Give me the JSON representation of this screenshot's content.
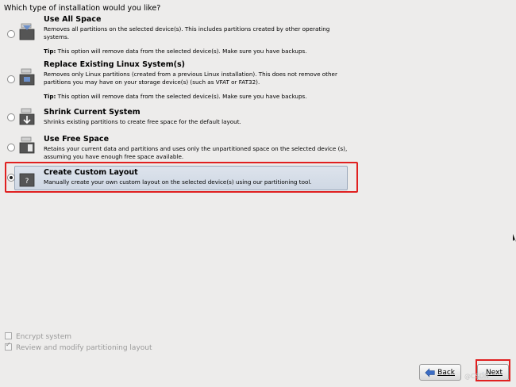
{
  "page": {
    "title": "Which type of installation would you like?"
  },
  "options": [
    {
      "title": "Use All Space",
      "description": "Removes all partitions on the selected device(s).  This includes partitions created by other operating systems.",
      "tip_label": "Tip:",
      "tip_text": " This option will remove data from the selected device(s).  Make sure you have backups.",
      "selected": false
    },
    {
      "title": "Replace Existing Linux System(s)",
      "description": "Removes only Linux partitions (created from a previous Linux installation).  This does not remove other partitions you may have on your storage device(s) (such as VFAT or FAT32).",
      "tip_label": "Tip:",
      "tip_text": " This option will remove data from the selected device(s).  Make sure you have backups.",
      "selected": false
    },
    {
      "title": "Shrink Current System",
      "description": "Shrinks existing partitions to create free space for the default layout.",
      "selected": false
    },
    {
      "title": "Use Free Space",
      "description": "Retains your current data and partitions and uses only the unpartitioned space on the selected device (s), assuming you have enough free space available.",
      "selected": false
    },
    {
      "title": "Create Custom Layout",
      "description": "Manually create your own custom layout on the selected device(s) using our partitioning tool.",
      "selected": true
    }
  ],
  "checkboxes": {
    "encrypt": {
      "label": "Encrypt system",
      "checked": false
    },
    "review": {
      "label": "Review and modify partitioning layout",
      "checked": true
    }
  },
  "buttons": {
    "back": "Back",
    "next": "Next"
  },
  "watermark": "@CSDN",
  "colors": {
    "highlight": "#e02020",
    "selection": "#cfd8e4"
  }
}
